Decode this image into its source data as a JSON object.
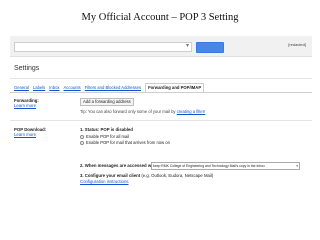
{
  "slide": {
    "title": "My Official Account – POP 3 Setting"
  },
  "topbar": {
    "user": "[redacted]"
  },
  "page": {
    "settings_title": "Settings"
  },
  "tabs": [
    {
      "label": "General",
      "active": false
    },
    {
      "label": "Labels",
      "active": false
    },
    {
      "label": "Inbox",
      "active": false
    },
    {
      "label": "Accounts",
      "active": false
    },
    {
      "label": "Filters and Blocked Addresses",
      "active": false
    },
    {
      "label": "Forwarding and POP/IMAP",
      "active": true
    }
  ],
  "forwarding": {
    "heading": "Forwarding:",
    "learn_more": "Learn more",
    "button": "Add a forwarding address",
    "tip_text": "Tip: You can also forward only some of your mail by",
    "tip_link": "creating a filter!"
  },
  "pop": {
    "heading": "POP Download:",
    "learn_more": "Learn more",
    "status": "1. Status: POP is disabled",
    "enable_all": "Enable POP for all mail",
    "enable_now": "Enable POP for mail that arrives from now on",
    "step2_prefix": "2. When messages are accessed with POP",
    "step2_select": "keep RMK College of Engineering and Technology Mail's copy in the Inbox",
    "step3": "3. Configure your email client",
    "step3_hint": "(e.g. Outlook, Eudora, Netscape Mail)",
    "config_link": "Configuration instructions"
  },
  "colors": {
    "link": "#1155cc",
    "search_button": "#4a86e8",
    "topbar": "#f1f1f1"
  }
}
